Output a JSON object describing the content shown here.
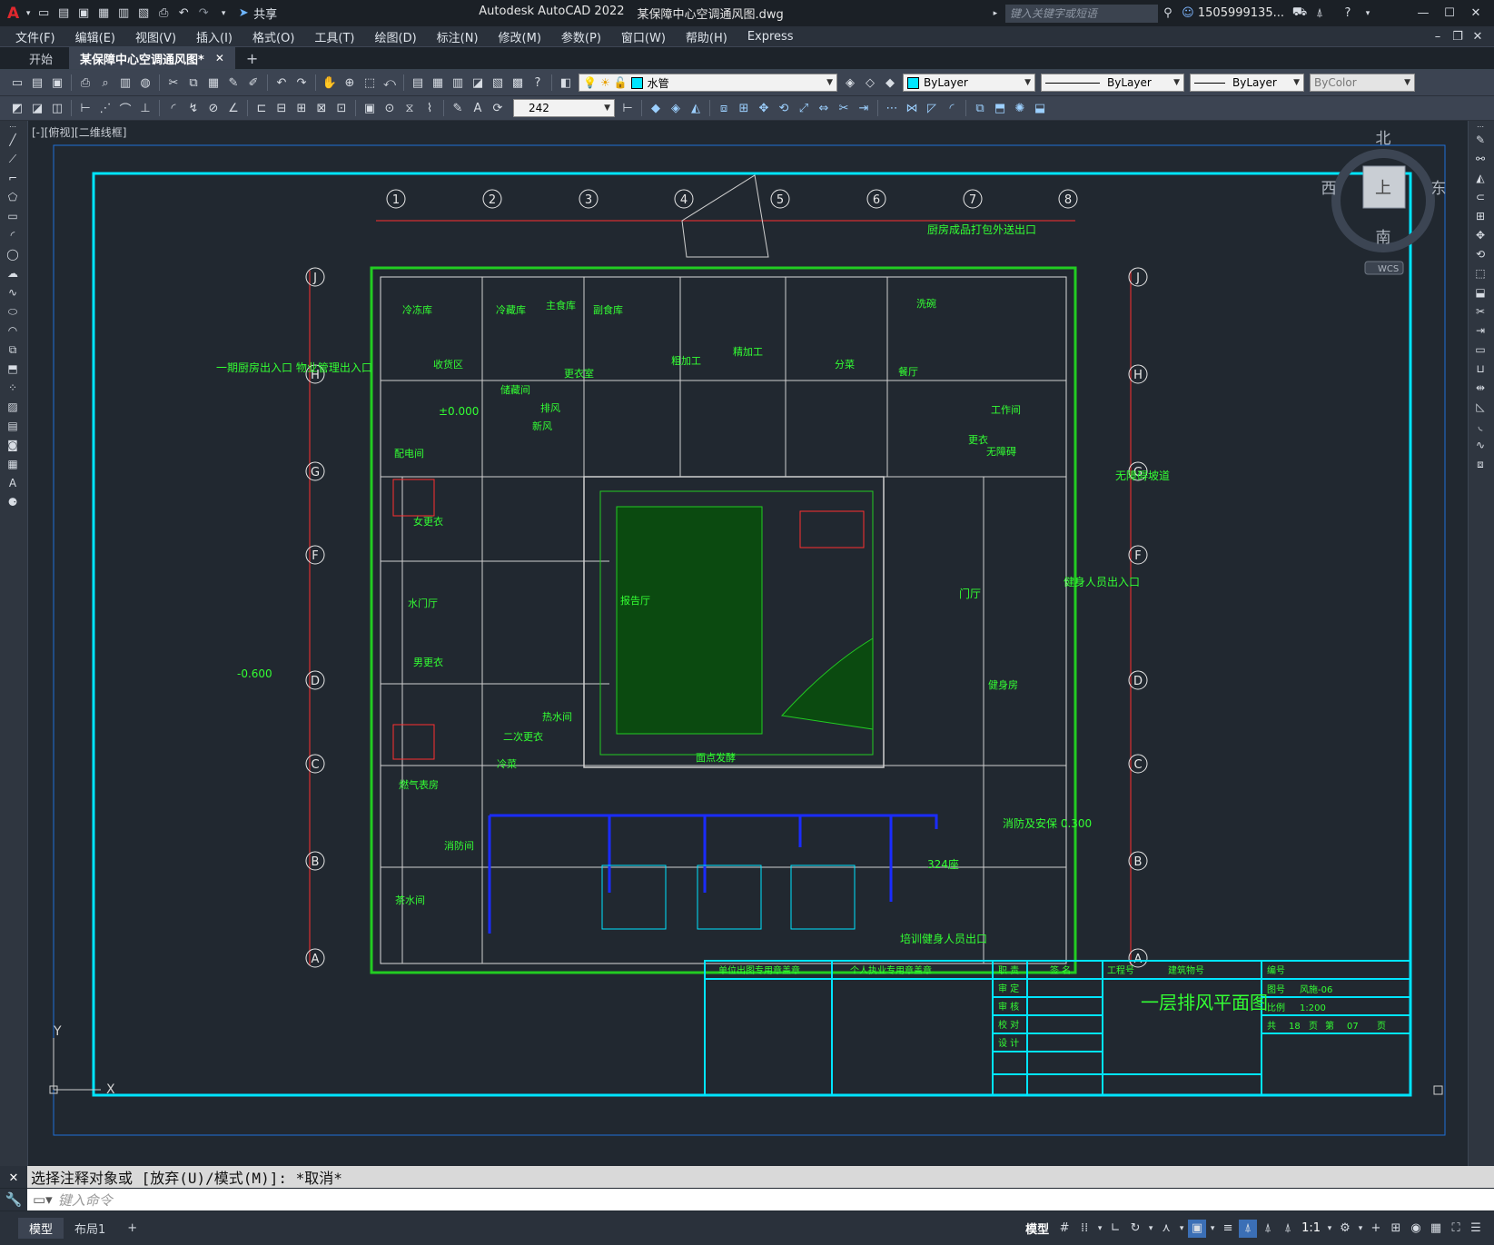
{
  "window": {
    "app_title": "Autodesk AutoCAD 2022",
    "file_title": "某保障中心空调通风图.dwg",
    "share_label": "共享",
    "search_placeholder": "键入关键字或短语",
    "user": "1505999135...",
    "controls": [
      "—",
      "☐",
      "✕"
    ]
  },
  "menus": [
    "文件(F)",
    "编辑(E)",
    "视图(V)",
    "插入(I)",
    "格式(O)",
    "工具(T)",
    "绘图(D)",
    "标注(N)",
    "修改(M)",
    "参数(P)",
    "窗口(W)",
    "帮助(H)",
    "Express"
  ],
  "tabs": [
    {
      "label": "开始",
      "active": false
    },
    {
      "label": "某保障中心空调通风图*",
      "active": true
    }
  ],
  "properties": {
    "layer": "水管",
    "color": "ByLayer",
    "linetype": "ByLayer",
    "lineweight": "ByLayer",
    "plotstyle": "ByColor",
    "dim_value": "242"
  },
  "viewport_label": "[-][俯视][二维线框]",
  "viewcube": {
    "north": "北",
    "south": "南",
    "east": "东",
    "west": "西",
    "top": "上",
    "wcs": "WCS"
  },
  "ucs": {
    "x": "X",
    "y": "Y"
  },
  "drawing": {
    "col_axes": [
      "1",
      "2",
      "3",
      "4",
      "5",
      "6",
      "7",
      "8"
    ],
    "row_axes": [
      "J",
      "H",
      "G",
      "F",
      "D",
      "C",
      "B",
      "A"
    ],
    "labels": {
      "kitchen_exit": "厨房成品打包外送出口",
      "staff_entry": "一期厨房出入口\n物业管理出入口",
      "level_main": "-0.600",
      "level_small": "±0.000",
      "barrier_free": "无障碍坡道",
      "lobby": "门厅",
      "side_entry": "健身人员出入口",
      "fire_room": "消防及安保\n0.300",
      "training_exit": "培训健身人员出口",
      "room_324": "324座"
    },
    "rooms": [
      "冷冻库",
      "冷藏库",
      "主食库",
      "副食库",
      "收货区",
      "粗加工",
      "精加工",
      "分菜",
      "洗碗",
      "餐厅",
      "更衣",
      "女更衣",
      "男更衣",
      "水门厅",
      "热水间",
      "配电间",
      "燃气表房",
      "消防间",
      "茶水间",
      "更衣室",
      "储藏间",
      "排风",
      "新风",
      "二次更衣",
      "面点发酵",
      "冷菜",
      "工作间",
      "无障碍",
      "报告厅",
      "健身房"
    ]
  },
  "title_block": {
    "seal_unit": "单位出图专用章盖章",
    "seal_personal": "个人执业专用章盖章",
    "roles": [
      "职 责",
      "审 定",
      "审 核",
      "校 对",
      "设 计"
    ],
    "sign_header": "签 名",
    "project_no_label": "工程号",
    "building_no_label": "建筑物号",
    "number_label": "编号",
    "drawing_title": "一层排风平面图",
    "sheet_label": "图号",
    "sheet_value": "风施-06",
    "scale_label": "比例",
    "scale_value": "1:200",
    "total_label": "共",
    "total_value": "18",
    "page_unit": "页",
    "page_label": "第",
    "page_value": "07"
  },
  "command": {
    "history": "选择注释对象或 [放弃(U)/模式(M)]: *取消*",
    "placeholder": "键入命令"
  },
  "layout_tabs": [
    {
      "label": "模型",
      "active": true
    },
    {
      "label": "布局1",
      "active": false
    }
  ],
  "status": {
    "model_label": "模型",
    "scale": "1:1"
  },
  "colors": {
    "frame": "#00e5ff",
    "wall": "#22cc22",
    "red": "#ff3030",
    "duct": "#1a2cff",
    "text": "#33ff33",
    "bg": "#212830"
  }
}
